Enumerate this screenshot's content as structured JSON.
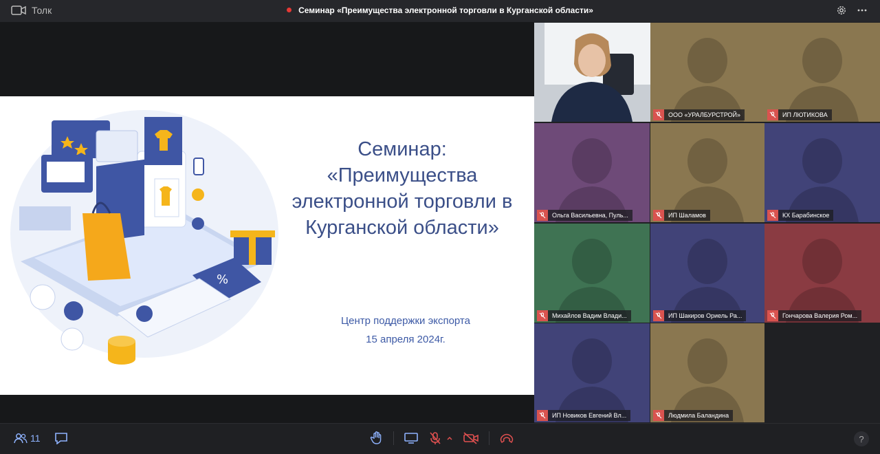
{
  "app": {
    "name": "Толк",
    "icon": "video-icon"
  },
  "meeting": {
    "title": "Семинар «Преимущества электронной торговли в Курганской области»",
    "recording": true
  },
  "slide": {
    "title_lines": [
      "Семинар:",
      "«Преимущества",
      "электронной торговли в",
      "Курганской области»"
    ],
    "subtitle_lines": [
      "Центр поддержки экспорта",
      "15 апреля 2024г."
    ]
  },
  "participants": [
    {
      "name": "",
      "video": true,
      "bg": "#d9dee3"
    },
    {
      "name": "ООО «УРАЛБУРСТРОЙ»",
      "muted": true,
      "bg": "#8a7750"
    },
    {
      "name": "ИП ЛЮТИКОВА",
      "muted": true,
      "bg": "#8a7750"
    },
    {
      "name": "Ольга Васильевна, Пуль...",
      "muted": true,
      "bg": "#6e4a78"
    },
    {
      "name": "ИП Шаламов",
      "muted": true,
      "bg": "#8a7750"
    },
    {
      "name": "КХ Барабинское",
      "muted": true,
      "bg": "#414378"
    },
    {
      "name": "Михайлов Вадим Влади...",
      "muted": true,
      "bg": "#3f7353"
    },
    {
      "name": "ИП Шакиров Ориель Ра...",
      "muted": true,
      "bg": "#414378"
    },
    {
      "name": "Гончарова Валерия Ром...",
      "muted": true,
      "bg": "#8a3b42"
    },
    {
      "name": "ИП Новиков Евгений Вл...",
      "muted": true,
      "bg": "#414378"
    },
    {
      "name": "Людмила Баландина",
      "muted": true,
      "bg": "#8a7750"
    }
  ],
  "bottom": {
    "participants_count": "11",
    "help_label": "?"
  }
}
